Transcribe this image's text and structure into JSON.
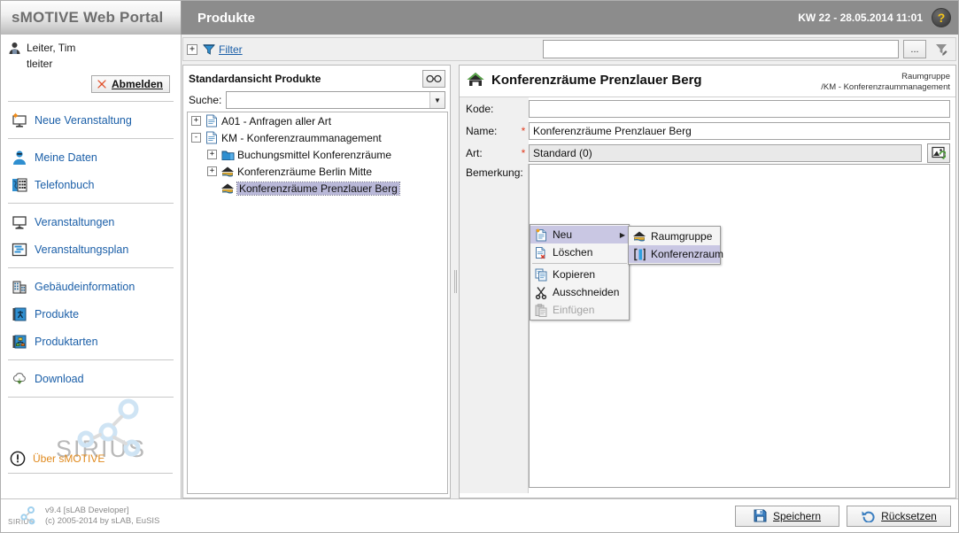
{
  "topbar": {
    "brand": "sMOTIVE Web Portal",
    "section_title": "Produkte",
    "clock": "KW 22 - 28.05.2014 11:01",
    "help_glyph": "?"
  },
  "sidebar": {
    "user_name": "Leiter, Tim",
    "user_login": "tleiter",
    "logout_label": "Abmelden",
    "items": [
      {
        "label": "Neue Veranstaltung",
        "icon": "new-event-icon"
      },
      {
        "label": "Meine Daten",
        "icon": "user-icon"
      },
      {
        "label": "Telefonbuch",
        "icon": "phonebook-icon"
      },
      {
        "label": "Veranstaltungen",
        "icon": "events-icon"
      },
      {
        "label": "Veranstaltungsplan",
        "icon": "event-plan-icon"
      },
      {
        "label": "Gebäudeinformation",
        "icon": "building-icon"
      },
      {
        "label": "Produkte",
        "icon": "products-icon"
      },
      {
        "label": "Produktarten",
        "icon": "product-types-icon"
      },
      {
        "label": "Download",
        "icon": "download-icon"
      }
    ],
    "logo_text": "SIRIUS",
    "about_label": "Über sMOTIVE"
  },
  "filterbar": {
    "expander_glyph": "+",
    "filter_label": "Filter",
    "filter_value": "",
    "more_label": "...",
    "clear_filter_icon": "filter-clear-icon"
  },
  "tree_panel": {
    "title": "Standardansicht Produkte",
    "view_icon": "glasses-icon",
    "search_label": "Suche:",
    "search_value": "",
    "nodes": [
      {
        "label": "A01 - Anfragen aller Art",
        "indent": 0,
        "toggle": "+",
        "icon": "document-icon",
        "selected": false
      },
      {
        "label": "KM - Konferenzraummanagement",
        "indent": 0,
        "toggle": "-",
        "icon": "document-icon",
        "selected": false
      },
      {
        "label": "Buchungsmittel Konferenzräume",
        "indent": 1,
        "toggle": "+",
        "icon": "folder-icon",
        "selected": false
      },
      {
        "label": "Konferenzräume Berlin Mitte",
        "indent": 1,
        "toggle": "+",
        "icon": "roomgroup-icon",
        "selected": false
      },
      {
        "label": "Konferenzräume Prenzlauer Berg",
        "indent": 1,
        "toggle": "",
        "icon": "roomgroup-icon",
        "selected": true
      }
    ]
  },
  "context_menu": {
    "items": [
      {
        "label": "Neu",
        "icon": "new-icon",
        "highlighted": true,
        "has_submenu": true,
        "disabled": false
      },
      {
        "label": "Löschen",
        "icon": "delete-icon",
        "highlighted": false,
        "has_submenu": false,
        "disabled": false
      },
      {
        "separator": true
      },
      {
        "label": "Kopieren",
        "icon": "copy-icon",
        "highlighted": false,
        "has_submenu": false,
        "disabled": false
      },
      {
        "label": "Ausschneiden",
        "icon": "cut-icon",
        "highlighted": false,
        "has_submenu": false,
        "disabled": false
      },
      {
        "label": "Einfügen",
        "icon": "paste-icon",
        "highlighted": false,
        "has_submenu": false,
        "disabled": true
      }
    ],
    "submenu": [
      {
        "label": "Raumgruppe",
        "icon": "roomgroup-icon",
        "highlighted": false
      },
      {
        "label": "Konferenzraum",
        "icon": "conference-room-icon",
        "highlighted": true
      }
    ]
  },
  "detail": {
    "title": "Konferenzräume Prenzlauer Berg",
    "title_icon": "roomgroup-icon",
    "type_label": "Raumgruppe",
    "path_label": "/KM - Konferenzraummanagement",
    "fields": [
      {
        "label": "Kode:",
        "required": false,
        "value": "",
        "readonly": false
      },
      {
        "label": "Name:",
        "required": true,
        "value": "Konferenzräume Prenzlauer Berg",
        "readonly": false
      },
      {
        "label": "Art:",
        "required": true,
        "value": "Standard (0)",
        "readonly": true,
        "picker_icon": "picker-icon"
      }
    ],
    "note_label": "Bemerkung:",
    "note_value": ""
  },
  "footer": {
    "version_line1": "v9.4 [sLAB Developer]",
    "version_line2": "(c) 2005-2014 by sLAB, EuSIS",
    "save_label": "Speichern",
    "reset_label": "Rücksetzen"
  },
  "colors": {
    "accent_link": "#1b5fa8",
    "topbar_bg": "#8c8c8c",
    "selection": "#b9b8d8",
    "required_star": "#e03a1e",
    "about_orange": "#e08a1e"
  }
}
